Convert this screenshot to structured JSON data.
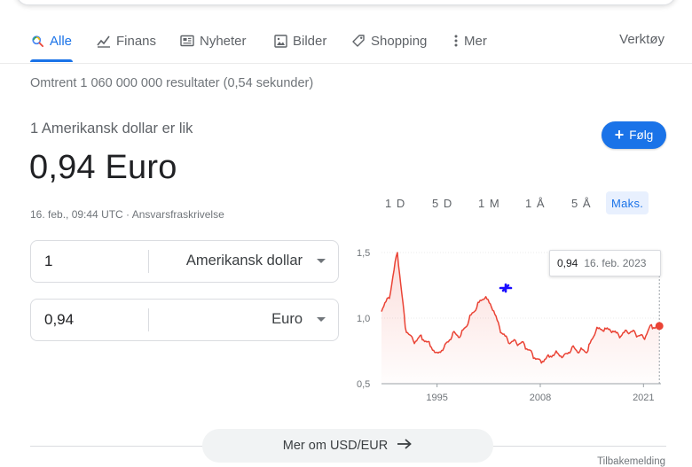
{
  "tabs": [
    {
      "label": "Alle",
      "icon": "search-icon",
      "active": true
    },
    {
      "label": "Finans",
      "icon": "finance-chart-icon"
    },
    {
      "label": "Nyheter",
      "icon": "news-icon"
    },
    {
      "label": "Bilder",
      "icon": "image-icon"
    },
    {
      "label": "Shopping",
      "icon": "tag-icon"
    },
    {
      "label": "Mer",
      "icon": "more-vertical-icon"
    }
  ],
  "tools_label": "Verktøy",
  "result_stats": "Omtrent 1 060 000 000 resultater (0,54 sekunder)",
  "converter": {
    "label": "1 Amerikansk dollar er lik",
    "value": "0,94 Euro",
    "meta": "16. feb., 09:44 UTC · Ansvarsfraskrivelse",
    "follow_label": "Følg",
    "from": {
      "amount": "1",
      "unit": "Amerikansk dollar"
    },
    "to": {
      "amount": "0,94",
      "unit": "Euro"
    }
  },
  "ranges": [
    "1 D",
    "5 D",
    "1 M",
    "1 Å",
    "5 Å",
    "Maks."
  ],
  "active_range": "Maks.",
  "tooltip": {
    "value": "0,94",
    "date": "16. feb. 2023"
  },
  "chart_data": {
    "type": "area",
    "series": [
      {
        "x": [
          1988,
          1989,
          1990,
          1991,
          1992,
          1993,
          1994,
          1995,
          1996,
          1997,
          1998,
          1999,
          2000,
          2001,
          2002,
          2003,
          2004,
          2005,
          2006,
          2007,
          2008,
          2009,
          2010,
          2011,
          2012,
          2013,
          2014,
          2015,
          2016,
          2017,
          2018,
          2019,
          2020,
          2021,
          2022,
          2023
        ],
        "values": [
          1.05,
          1.15,
          1.5,
          0.93,
          0.83,
          0.87,
          0.82,
          0.74,
          0.8,
          0.89,
          0.87,
          0.98,
          1.08,
          1.15,
          1.06,
          0.89,
          0.81,
          0.81,
          0.8,
          0.73,
          0.68,
          0.72,
          0.75,
          0.72,
          0.78,
          0.75,
          0.75,
          0.9,
          0.9,
          0.89,
          0.85,
          0.89,
          0.88,
          0.85,
          0.95,
          0.94
        ]
      }
    ],
    "color": "#ea4335",
    "xticks": [
      "1995",
      "2008",
      "2021"
    ],
    "yticks": [
      "0,5",
      "1,0",
      "1,5"
    ],
    "ylim": [
      0.5,
      1.5
    ],
    "xlim": [
      1988,
      2023.2
    ]
  },
  "more_label": "Mer om USD/EUR",
  "feedback_label": "Tilbakemelding"
}
